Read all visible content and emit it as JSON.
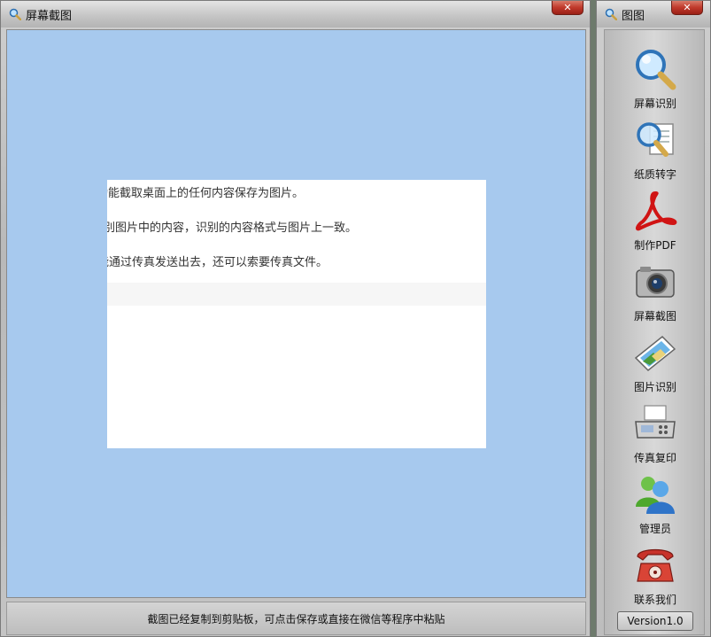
{
  "main_window": {
    "title": "屏幕截图",
    "close_label": "✕",
    "capture": {
      "lines": [
        "功能截取桌面上的任何内容保存为图片。",
        "别图片中的内容，识别的内容格式与图片上一致。",
        "能通过传真发送出去，还可以索要传真文件。"
      ]
    },
    "status": "截图已经复制到剪贴板，可点击保存或直接在微信等程序中粘贴"
  },
  "side_window": {
    "title": "图图",
    "close_label": "✕",
    "tools": [
      {
        "label": "屏幕识别",
        "icon": "magnifier-icon"
      },
      {
        "label": "纸质转字",
        "icon": "document-scan-icon"
      },
      {
        "label": "制作PDF",
        "icon": "pdf-icon"
      },
      {
        "label": "屏幕截图",
        "icon": "camera-icon"
      },
      {
        "label": "图片识别",
        "icon": "picture-icon"
      },
      {
        "label": "传真复印",
        "icon": "fax-icon"
      },
      {
        "label": "管理员",
        "icon": "users-icon"
      },
      {
        "label": "联系我们",
        "icon": "telephone-icon"
      }
    ],
    "version": "Version1.0"
  },
  "colors": {
    "canvas_bg": "#a7c9ee",
    "close_button": "#c0392b",
    "pdf_red": "#d01414"
  }
}
